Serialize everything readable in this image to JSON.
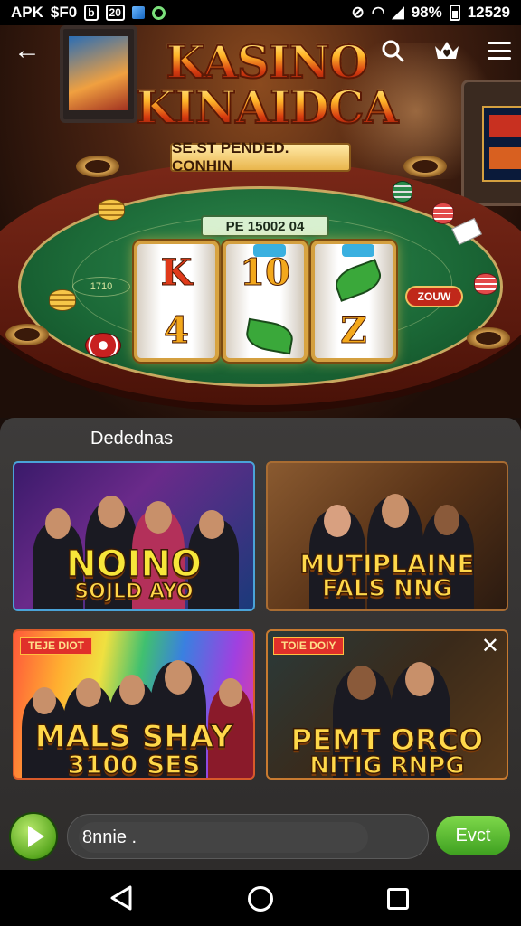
{
  "status_bar": {
    "left_text": "APK",
    "left_text2": "$F0",
    "left_box": "b",
    "left_num": "20",
    "battery_pct": "98%",
    "time": "12529"
  },
  "hero": {
    "logo_line1": "KASINO",
    "logo_line2": "KINAIDCA",
    "logo_subtitle": "SE.ST PENDED. CONHIN",
    "payout_label": "PE 15002 04",
    "left_bet_label": "1710",
    "right_bet_label": "ZOUW",
    "reels": [
      {
        "top": "K",
        "bottom": "4"
      },
      {
        "top": "10",
        "bottom": ""
      },
      {
        "top": "",
        "bottom": "Z"
      }
    ]
  },
  "panel": {
    "title": "Dedednas",
    "cards": [
      {
        "title_line1": "NOINO",
        "title_line2": "SOJLD AYO",
        "tag": ""
      },
      {
        "title_line1": "MUTIPLAINE",
        "title_line2": "FALS NNG",
        "tag": ""
      },
      {
        "title_line1": "MALS SHAY",
        "title_line2": "3100 SES",
        "tag": "TEJE DIOT"
      },
      {
        "title_line1": "PEMT ORCO",
        "title_line2": "NITIG RNPG",
        "tag": "TOIE DOIY"
      }
    ]
  },
  "bottom_bar": {
    "search_value": "8nnie .",
    "action_label": "Evct"
  },
  "icons": {
    "back": "arrow-left",
    "search": "magnifier",
    "crown": "crown-heart",
    "menu": "hamburger",
    "play": "play-triangle",
    "settings": "hexagon-gear",
    "close": "x"
  }
}
